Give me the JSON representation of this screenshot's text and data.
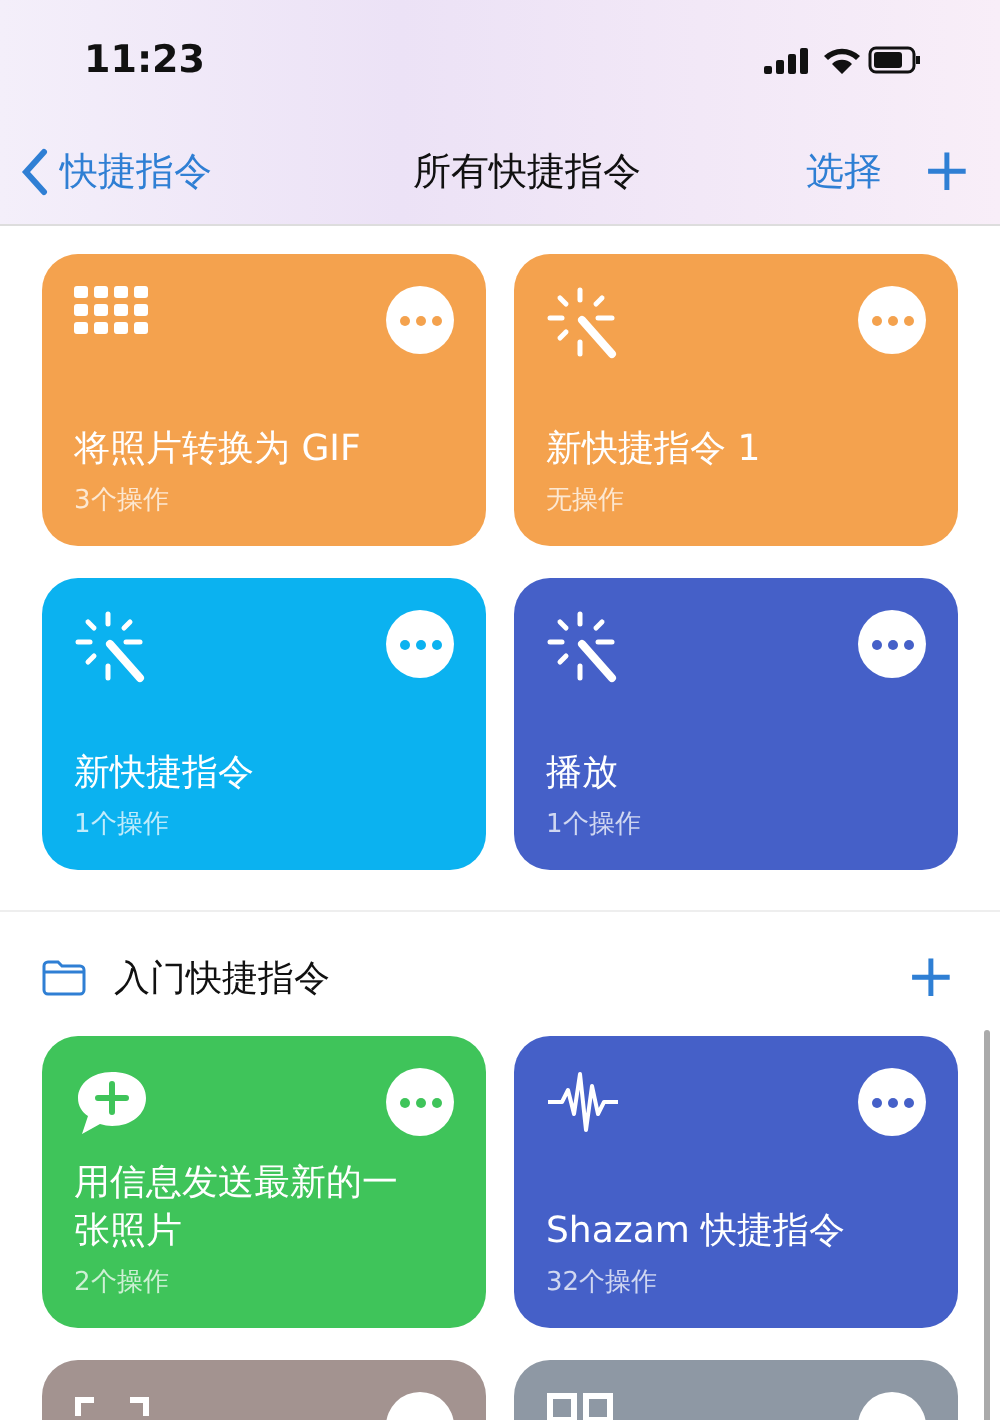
{
  "status_bar": {
    "time": "11:23"
  },
  "nav": {
    "back": "快捷指令",
    "title": "所有快捷指令",
    "action": "选择",
    "add": "+"
  },
  "shortcuts": [
    {
      "title": "将照片转换为 GIF",
      "subtitle": "3个操作",
      "kind": "grid",
      "color": "#f4a24e"
    },
    {
      "title": "新快捷指令 1",
      "subtitle": "无操作",
      "kind": "wand",
      "color": "#f4a24e"
    },
    {
      "title": "新快捷指令",
      "subtitle": "1个操作",
      "kind": "wand",
      "color": "#0bb2f0"
    },
    {
      "title": "播放",
      "subtitle": "1个操作",
      "kind": "wand",
      "color": "#4560c8"
    }
  ],
  "folder": {
    "title": "入门快捷指令",
    "add": "+",
    "shortcuts": [
      {
        "title": "用信息发送最新的一张照片",
        "subtitle": "2个操作",
        "kind": "message",
        "color": "#3fc45a"
      },
      {
        "title": "Shazam 快捷指令",
        "subtitle": "32个操作",
        "kind": "waveform",
        "color": "#4560c8"
      },
      {
        "kind": "camera",
        "color": "#a39390"
      },
      {
        "kind": "qr",
        "color": "#8e98a4"
      }
    ]
  }
}
